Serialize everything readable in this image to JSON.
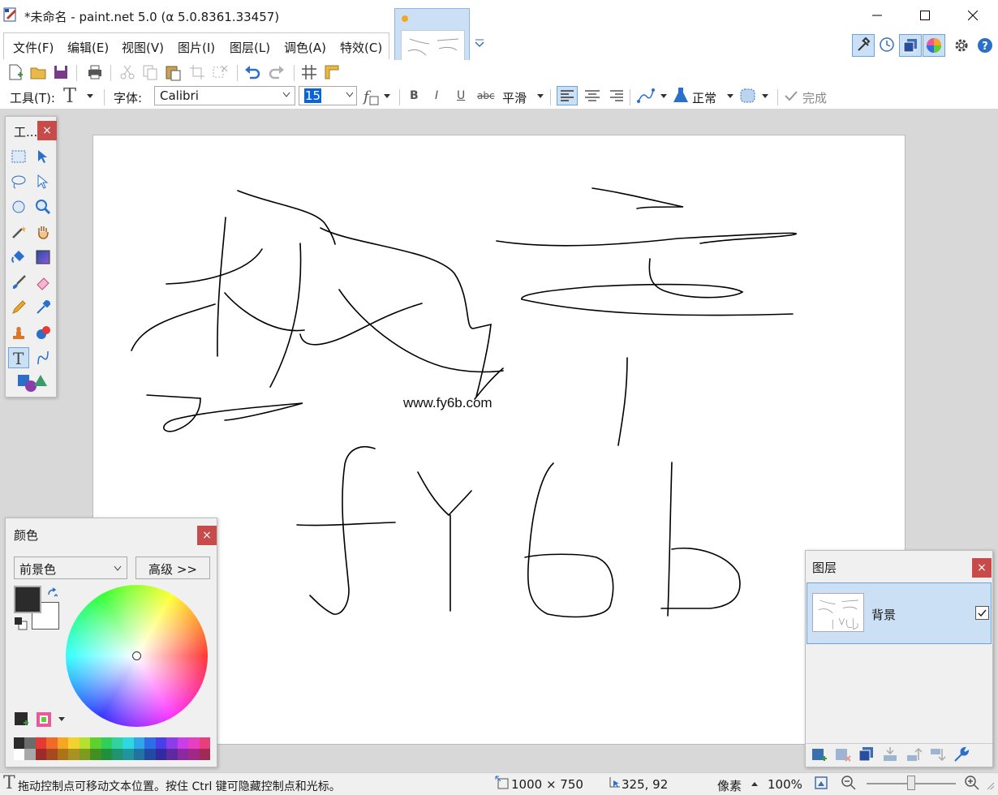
{
  "window": {
    "title": "*未命名 - paint.net 5.0 (α 5.0.8361.33457)"
  },
  "menu": [
    "文件(F)",
    "编辑(E)",
    "视图(V)",
    "图片(I)",
    "图层(L)",
    "调色(A)",
    "特效(C)"
  ],
  "text_toolbar": {
    "tool_label": "工具(T):",
    "font_label": "字体:",
    "font_value": "Calibri",
    "size_value": "15",
    "bold": "B",
    "italic": "I",
    "underline": "U",
    "strike": "abc",
    "smoothing": "平滑",
    "blend_mode": "正常",
    "finish_label": "完成"
  },
  "tools_panel": {
    "title": "工..."
  },
  "canvas": {
    "text": "www.fy6b.com"
  },
  "colors_panel": {
    "title": "颜色",
    "mode": "前景色",
    "advanced_button": "高级 >>",
    "primary_color": "#2b2b2b",
    "secondary_color": "#ffffff"
  },
  "layers_panel": {
    "title": "图层",
    "layers": [
      {
        "name": "背景",
        "visible": true
      }
    ]
  },
  "status": {
    "hint": "拖动控制点可移动文本位置。按住 Ctrl 键可隐藏控制点和光标。",
    "image_size": "1000 × 750",
    "cursor_pos": "325, 92",
    "units": "像素",
    "zoom": "100%"
  },
  "palette_top": [
    "#2b2b2b",
    "#6b6b6b",
    "#e53935",
    "#f06a2a",
    "#f5a623",
    "#f2d22e",
    "#b6e02e",
    "#5fd12f",
    "#2ecf5a",
    "#2ed3a0",
    "#2ed8e0",
    "#2ea6e8",
    "#2e6ce8",
    "#4a3ee8",
    "#8a3ee8",
    "#c93ee8",
    "#e83ec0",
    "#e83e7a"
  ],
  "palette_bottom": [
    "#ffffff",
    "#a8a8a8",
    "#9e2a2a",
    "#a8491d",
    "#ab7419",
    "#a99220",
    "#7e9b20",
    "#429120",
    "#20903f",
    "#209370",
    "#20969c",
    "#2074a1",
    "#204ba1",
    "#3329a1",
    "#5f29a1",
    "#8c29a1",
    "#a12985",
    "#a12955"
  ],
  "accent": "#3399ff"
}
